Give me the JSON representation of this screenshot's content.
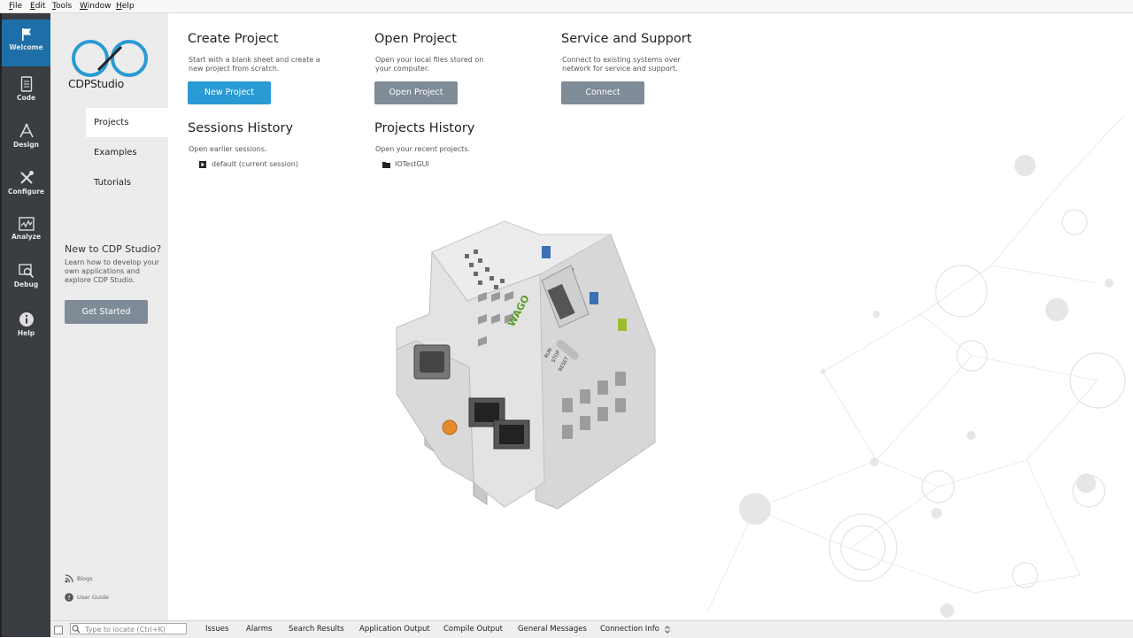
{
  "menu": [
    "File",
    "Edit",
    "Tools",
    "Window",
    "Help"
  ],
  "modes": [
    {
      "label": "Welcome",
      "icon": "flag-icon",
      "active": true
    },
    {
      "label": "Code",
      "icon": "document-icon"
    },
    {
      "label": "Design",
      "icon": "design-icon"
    },
    {
      "label": "Configure",
      "icon": "tools-icon"
    },
    {
      "label": "Analyze",
      "icon": "chart-icon"
    },
    {
      "label": "Debug",
      "icon": "debug-icon"
    },
    {
      "label": "Help",
      "icon": "info-icon"
    }
  ],
  "logo": {
    "text": "CDPStudio",
    "color": "#2a9ad4"
  },
  "nav": [
    "Projects",
    "Examples",
    "Tutorials"
  ],
  "newto": {
    "title": "New to CDP Studio?",
    "desc": "Learn how to develop your own applications and explore CDP Studio.",
    "button": "Get Started"
  },
  "links": {
    "blogs": "Blogs",
    "guide": "User Guide"
  },
  "sections": {
    "create": {
      "title": "Create Project",
      "desc": "Start with a blank sheet and create a new project from scratch.",
      "button": "New Project"
    },
    "open": {
      "title": "Open Project",
      "desc": "Open your local files stored on your computer.",
      "button": "Open Project"
    },
    "service": {
      "title": "Service and Support",
      "desc": "Connect to existing systems over network for service and support.",
      "button": "Connect"
    },
    "sessions": {
      "title": "Sessions History",
      "desc": "Open earlier sessions.",
      "item": "default (current session)"
    },
    "projects": {
      "title": "Projects History",
      "desc": "Open your recent projects.",
      "item": "IOTestGUI"
    }
  },
  "device": {
    "brand": "WAGO",
    "labels": [
      "RUN",
      "STOP",
      "RESET"
    ]
  },
  "statusbar": {
    "locate_placeholder": "Type to locate (Ctrl+K)",
    "tabs": [
      "Issues",
      "Alarms",
      "Search Results",
      "Application Output",
      "Compile Output",
      "General Messages",
      "Connection Info"
    ]
  },
  "colors": {
    "accent": "#2a9ad4",
    "modebar": "#3a3d42",
    "active_mode": "#1e6fa8",
    "gray_button": "#7f8b97"
  }
}
